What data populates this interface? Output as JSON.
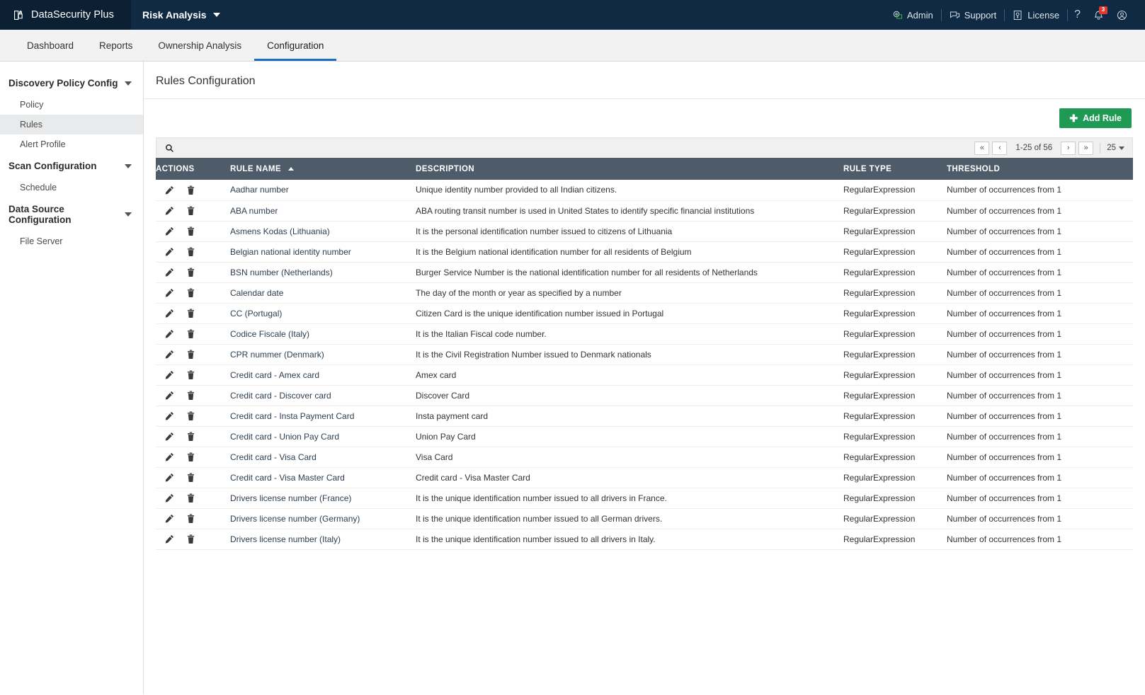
{
  "topbar": {
    "brand": "DataSecurity Plus",
    "brand_icon": "shield-lock-icon",
    "module": "Risk Analysis",
    "right_items": [
      {
        "label": "Admin",
        "icon": "admin-gear-screen-icon"
      },
      {
        "label": "Support",
        "icon": "support-chat-icon"
      },
      {
        "label": "License",
        "icon": "license-key-icon"
      }
    ],
    "help_glyph": "?",
    "notification_icon": "bell-icon",
    "notification_count": "3",
    "profile_icon": "user-avatar-icon"
  },
  "nav": {
    "tabs": [
      {
        "label": "Dashboard",
        "active": false
      },
      {
        "label": "Reports",
        "active": false
      },
      {
        "label": "Ownership Analysis",
        "active": false
      },
      {
        "label": "Configuration",
        "active": true
      }
    ]
  },
  "sidebar": {
    "groups": [
      {
        "label": "Discovery Policy Config",
        "items": [
          {
            "label": "Policy",
            "active": false
          },
          {
            "label": "Rules",
            "active": true
          },
          {
            "label": "Alert Profile",
            "active": false
          }
        ]
      },
      {
        "label": "Scan Configuration",
        "items": [
          {
            "label": "Schedule",
            "active": false
          }
        ]
      },
      {
        "label": "Data Source Configuration",
        "items": [
          {
            "label": "File Server",
            "active": false
          }
        ]
      }
    ]
  },
  "main": {
    "page_title": "Rules Configuration",
    "add_button": "Add Rule",
    "add_button_color": "#1f9a55",
    "search_placeholder": "",
    "search_value": "",
    "pagination": {
      "first": "«",
      "prev": "‹",
      "range": "1-25 of 56",
      "next": "›",
      "last": "»",
      "page_size": "25"
    },
    "table": {
      "columns": [
        "ACTIONS",
        "RULE NAME",
        "DESCRIPTION",
        "RULE TYPE",
        "THRESHOLD"
      ],
      "sorted_column": "RULE NAME",
      "sort_direction": "asc",
      "rows": [
        {
          "name": "Aadhar number",
          "description": "Unique identity number provided to all Indian citizens.",
          "type": "RegularExpression",
          "threshold": "Number of occurrences from 1"
        },
        {
          "name": "ABA number",
          "description": "ABA routing transit number is used in United States to identify specific financial institutions",
          "type": "RegularExpression",
          "threshold": "Number of occurrences from 1"
        },
        {
          "name": "Asmens Kodas (Lithuania)",
          "description": "It is the personal identification number issued to citizens of Lithuania",
          "type": "RegularExpression",
          "threshold": "Number of occurrences from 1"
        },
        {
          "name": "Belgian national identity number",
          "description": "It is the Belgium national identification number for all residents of Belgium",
          "type": "RegularExpression",
          "threshold": "Number of occurrences from 1"
        },
        {
          "name": "BSN number (Netherlands)",
          "description": "Burger Service Number is the national identification number for all residents of Netherlands",
          "type": "RegularExpression",
          "threshold": "Number of occurrences from 1"
        },
        {
          "name": "Calendar date",
          "description": "The day of the month or year as specified by a number",
          "type": "RegularExpression",
          "threshold": "Number of occurrences from 1"
        },
        {
          "name": "CC (Portugal)",
          "description": "Citizen Card is the unique identification number issued in Portugal",
          "type": "RegularExpression",
          "threshold": "Number of occurrences from 1"
        },
        {
          "name": "Codice Fiscale (Italy)",
          "description": "It is the Italian Fiscal code number.",
          "type": "RegularExpression",
          "threshold": "Number of occurrences from 1"
        },
        {
          "name": "CPR nummer (Denmark)",
          "description": "It is the Civil Registration Number issued to Denmark nationals",
          "type": "RegularExpression",
          "threshold": "Number of occurrences from 1"
        },
        {
          "name": "Credit card - Amex card",
          "description": "Amex card",
          "type": "RegularExpression",
          "threshold": "Number of occurrences from 1"
        },
        {
          "name": "Credit card - Discover card",
          "description": "Discover Card",
          "type": "RegularExpression",
          "threshold": "Number of occurrences from 1"
        },
        {
          "name": "Credit card - Insta Payment Card",
          "description": "Insta payment card",
          "type": "RegularExpression",
          "threshold": "Number of occurrences from 1"
        },
        {
          "name": "Credit card - Union Pay Card",
          "description": "Union Pay Card",
          "type": "RegularExpression",
          "threshold": "Number of occurrences from 1"
        },
        {
          "name": "Credit card - Visa Card",
          "description": "Visa Card",
          "type": "RegularExpression",
          "threshold": "Number of occurrences from 1"
        },
        {
          "name": "Credit card - Visa Master Card",
          "description": "Credit card - Visa Master Card",
          "type": "RegularExpression",
          "threshold": "Number of occurrences from 1"
        },
        {
          "name": "Drivers license number (France)",
          "description": "It is the unique identification number issued to all drivers in France.",
          "type": "RegularExpression",
          "threshold": "Number of occurrences from 1"
        },
        {
          "name": "Drivers license number (Germany)",
          "description": "It is the unique identification number issued to all German drivers.",
          "type": "RegularExpression",
          "threshold": "Number of occurrences from 1"
        },
        {
          "name": "Drivers license number (Italy)",
          "description": "It is the unique identification number issued to all drivers in Italy.",
          "type": "RegularExpression",
          "threshold": "Number of occurrences from 1"
        }
      ],
      "row_actions": [
        {
          "icon": "edit-pencil-icon",
          "name": "edit-rule-button"
        },
        {
          "icon": "delete-trash-icon",
          "name": "delete-rule-button"
        }
      ]
    }
  }
}
